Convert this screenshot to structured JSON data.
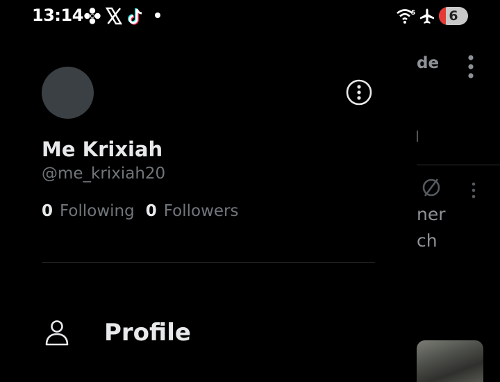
{
  "status_bar": {
    "time": "13:14",
    "notification_icons": [
      "pinwheel-icon",
      "x-logo-icon",
      "tiktok-icon"
    ],
    "system_icons": [
      "wifi-icon",
      "airplane-mode-icon"
    ],
    "battery_level": "6",
    "battery_color": "#e53935"
  },
  "drawer": {
    "display_name": "Me Krixiah",
    "handle": "@me_krixiah20",
    "following_count": "0",
    "following_label": "Following",
    "followers_count": "0",
    "followers_label": "Followers",
    "nav_items": [
      {
        "label": "Profile",
        "icon": "person-icon"
      }
    ]
  },
  "background": {
    "tab_fragment": "de",
    "line1_fragment": "ner",
    "line2_fragment": "ch"
  },
  "colors": {
    "background": "#000000",
    "primary_text": "#e7e9ea",
    "secondary_text": "#71767b",
    "avatar_placeholder": "#3b4044",
    "divider": "#2f3336"
  }
}
